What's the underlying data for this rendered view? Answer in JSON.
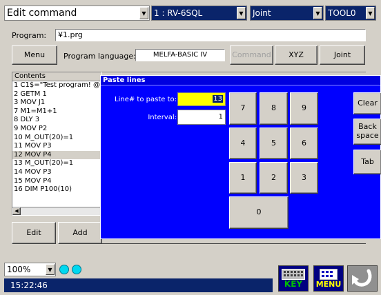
{
  "title_combo": "Edit command",
  "robot_combo": "1 : RV-6SQL",
  "jog_mode_combo": "Joint",
  "tool_combo": "TOOL0",
  "program": {
    "label": "Program:",
    "value": "¥1.prg"
  },
  "toolbar": {
    "menu_label": "Menu",
    "language_label": "Program language:",
    "language_value": "MELFA-BASIC IV",
    "command_label": "Command",
    "xyz_label": "XYZ",
    "joint_label": "Joint"
  },
  "list": {
    "header": "Contents",
    "rows": [
      "1 C1$=\"Test program! @",
      "2 GETM 1",
      "3 MOV J1",
      "7 M1=M1+1",
      "8 DLY 3",
      "9 MOV P2",
      "10 M_OUT(20)=1",
      "11 MOV P3",
      "12 MOV P4",
      "13 M_OUT(20)=1",
      "14 MOV P3",
      "15 MOV P4",
      "16 DIM P100(10)"
    ],
    "selected_index": 8
  },
  "bottom_buttons": {
    "edit": "Edit",
    "add": "Add"
  },
  "dialog": {
    "title": "Paste lines",
    "line_label": "Line# to paste to:",
    "line_value": "13",
    "interval_label": "Interval:",
    "interval_value": "1",
    "keys": [
      "7",
      "8",
      "9",
      "4",
      "5",
      "6",
      "1",
      "2",
      "3",
      "0"
    ],
    "clear_label": "Clear",
    "backspace_label": "Back space",
    "tab_label": "Tab"
  },
  "zoom_combo": "100%",
  "clock": "15:22:46",
  "key_icon_label": "KEY",
  "menu_icon_label": "MENU",
  "colors": {
    "dialog_bg": "#0000ff",
    "status_bg": "#0a246a",
    "highlight_field": "#ffff00",
    "indicator": "#00d8f0",
    "icon_green": "#00c000"
  }
}
